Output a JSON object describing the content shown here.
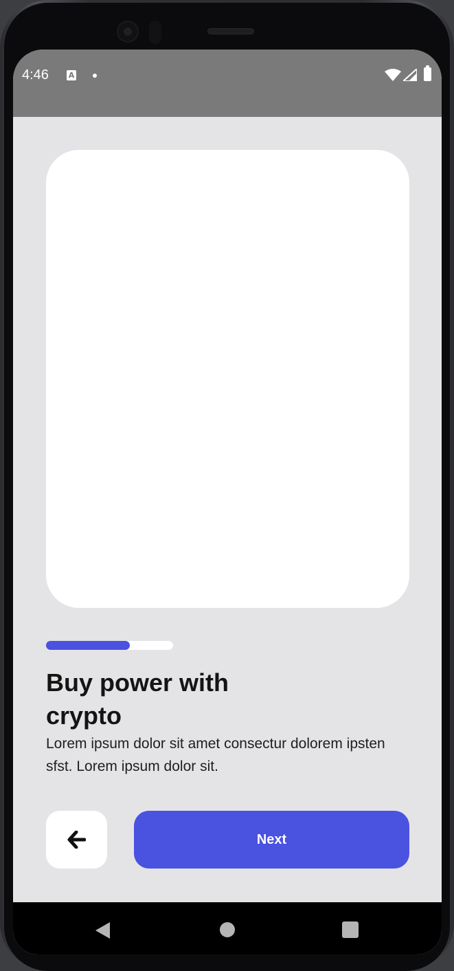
{
  "status_bar": {
    "time": "4:46",
    "notification_icon": "A",
    "icons": [
      "text-a-icon",
      "dot-icon",
      "wifi-icon",
      "signal-icon",
      "battery-icon"
    ]
  },
  "onboarding": {
    "progress_fraction": 0.66,
    "title": "Buy power with crypto",
    "description": "Lorem ipsum dolor sit amet consectur dolorem ipsten sfst. Lorem ipsum dolor sit.",
    "back_icon": "arrow-left-icon",
    "next_label": "Next"
  },
  "nav_bar": {
    "icons": [
      "triangle-back-icon",
      "circle-home-icon",
      "square-recents-icon"
    ]
  },
  "colors": {
    "accent": "#4a52e0",
    "background": "#e4e4e6",
    "card": "#ffffff",
    "status_bar": "#7a7a7a",
    "title_text": "#141414"
  }
}
